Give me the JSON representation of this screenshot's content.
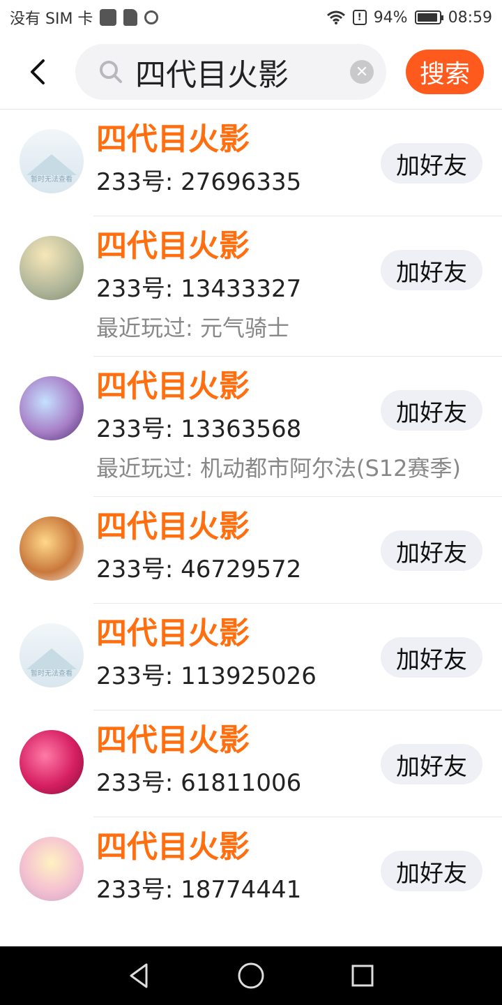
{
  "status_bar": {
    "carrier": "没有 SIM 卡",
    "battery": "94%",
    "battery_level": 0.94,
    "time": "08:59"
  },
  "header": {
    "search_value": "四代目火影",
    "search_button": "搜索"
  },
  "results": [
    {
      "name": "四代目火影",
      "uid": "233号: 27696335",
      "played": "",
      "add": "加好友",
      "avatar_caption": "暂时无法查看"
    },
    {
      "name": "四代目火影",
      "uid": "233号: 13433327",
      "played": "最近玩过: 元气骑士",
      "add": "加好友"
    },
    {
      "name": "四代目火影",
      "uid": "233号: 13363568",
      "played": "最近玩过: 机动都市阿尔法(S12赛季)",
      "add": "加好友"
    },
    {
      "name": "四代目火影",
      "uid": "233号: 46729572",
      "played": "",
      "add": "加好友"
    },
    {
      "name": "四代目火影",
      "uid": "233号: 113925026",
      "played": "",
      "add": "加好友",
      "avatar_caption": "暂时无法查看"
    },
    {
      "name": "四代目火影",
      "uid": "233号: 61811006",
      "played": "",
      "add": "加好友"
    },
    {
      "name": "四代目火影",
      "uid": "233号: 18774441",
      "played": "",
      "add": "加好友"
    }
  ],
  "colors": {
    "accent": "#ff5a1e",
    "name": "#ff6f0f"
  }
}
